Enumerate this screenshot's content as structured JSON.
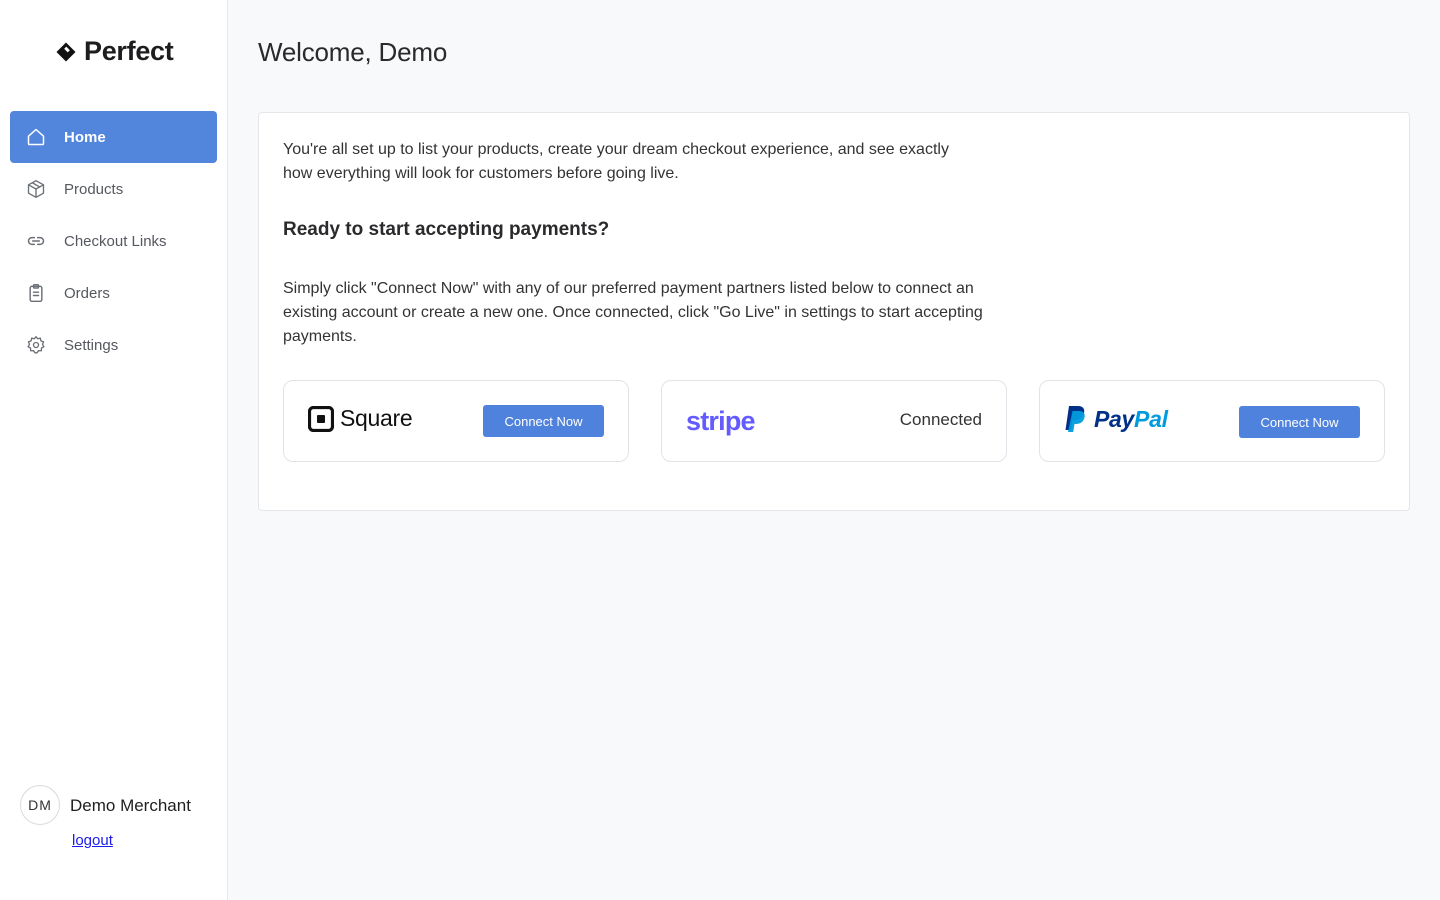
{
  "brand": {
    "name": "Perfect",
    "icon": "tag-diamond-icon"
  },
  "sidebar": {
    "items": [
      {
        "label": "Home",
        "icon": "home-icon",
        "active": true
      },
      {
        "label": "Products",
        "icon": "box-icon",
        "active": false
      },
      {
        "label": "Checkout Links",
        "icon": "link-icon",
        "active": false
      },
      {
        "label": "Orders",
        "icon": "clipboard-icon",
        "active": false
      },
      {
        "label": "Settings",
        "icon": "gear-icon",
        "active": false
      }
    ],
    "user": {
      "initials": "DM",
      "name": "Demo Merchant",
      "logout_label": "logout"
    }
  },
  "main": {
    "title": "Welcome, Demo",
    "intro": "You're all set up to list your products, create your dream checkout experience, and see exactly how everything will look for customers before going live.",
    "subheading": "Ready to start accepting payments?",
    "body": "Simply click \"Connect Now\" with any of our preferred payment partners listed below to connect an existing account or create a new one. Once connected, click \"Go Live\" in settings to start accepting payments.",
    "providers": [
      {
        "name": "Square",
        "status": "not_connected",
        "action_label": "Connect Now"
      },
      {
        "name": "stripe",
        "status": "connected",
        "status_label": "Connected"
      },
      {
        "name_part1": "Pay",
        "name_part2": "Pal",
        "status": "not_connected",
        "action_label": "Connect Now"
      }
    ]
  },
  "colors": {
    "accent": "#5285dc",
    "button": "#4f82dc",
    "stripe": "#635bff",
    "paypal_dark": "#003087",
    "paypal_light": "#009cde"
  }
}
